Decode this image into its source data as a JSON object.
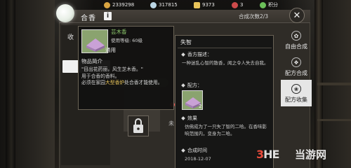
{
  "topbar": {
    "resources": [
      {
        "icon": "copper-coin-icon",
        "value": "2339298",
        "color": "#d9a441"
      },
      {
        "icon": "silver-coin-icon",
        "value": "317815",
        "color": "#bcd7e6"
      },
      {
        "icon": "gold-ingot-icon",
        "value": "9373",
        "color": "#e8c45a"
      },
      {
        "icon": "token-icon",
        "value": "3",
        "color": "#cc4a4a"
      }
    ],
    "points_label": "积分",
    "points_icon_color": "#6bbf59"
  },
  "panel": {
    "title": "合香",
    "info_symbol": "i",
    "compose_count": "合成次数2/3",
    "close_symbol": "✕",
    "left_heading": "收",
    "partial_unlock_text": "未"
  },
  "tabs": [
    {
      "label": "自由合成",
      "icon": "incense-burner-icon",
      "active": false
    },
    {
      "label": "配方合成",
      "icon": "recipe-book-icon",
      "active": false
    },
    {
      "label": "配方收集",
      "icon": "scroll-icon",
      "active": true
    }
  ],
  "item_popup": {
    "name": "芸木香",
    "level": "使用等级: 60级",
    "type": "通用",
    "intro_heading": "物品简介",
    "desc_line1": "\"目出花药丽，风生芝木香。\"",
    "desc_line2": "用于合香的香料。",
    "desc_line3_pre": "必须在家园",
    "desc_line3_hl": "大型香炉",
    "desc_line3_post": "处合香才能使用。",
    "thumb_color": "#8aa36f"
  },
  "detail_popup": {
    "title": "失智",
    "desc_heading": "香方描述：",
    "desc_text": "一种迷乱心智的散香，闻之令人失去自我。",
    "recipe_heading": "配方：",
    "recipe_count": "2",
    "effect_heading": "效果",
    "effect_text": "仿佛成为了一只失了智的二哈。在香味影响范围内，变身为二哈。",
    "time_heading": "合成时间",
    "time_value": "2018-12-07"
  },
  "watermark": {
    "logo_pre": "3",
    "logo_post": "HE",
    "text": "当游网"
  }
}
